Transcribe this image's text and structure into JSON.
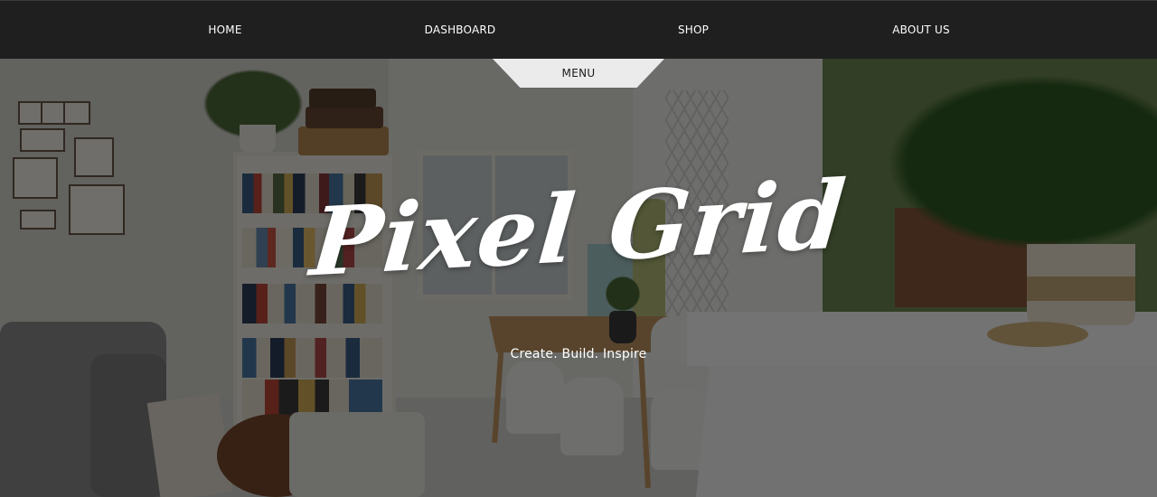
{
  "nav": {
    "items": [
      {
        "label": "HOME"
      },
      {
        "label": "DASHBOARD"
      },
      {
        "label": "SHOP"
      },
      {
        "label": "ABOUT US"
      }
    ]
  },
  "menu": {
    "label": "MENU"
  },
  "hero": {
    "title": "Pixel Grid",
    "tagline": "Create. Build. Inspire",
    "background_description_icon": "interior-room-photo"
  },
  "colors": {
    "nav_background": "#1f1f1f",
    "nav_text": "#ffffff",
    "menu_tab_background": "#ebebeb",
    "menu_tab_text": "#1a1a1a",
    "hero_text": "#ffffff"
  }
}
